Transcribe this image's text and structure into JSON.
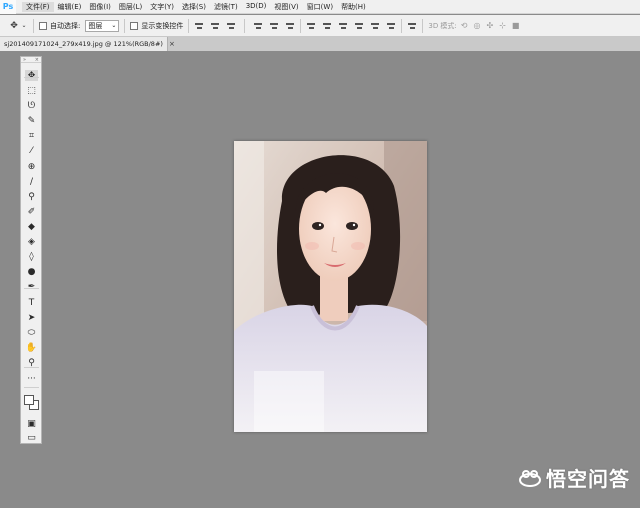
{
  "app": {
    "logo": "Ps"
  },
  "menu": [
    "文件(F)",
    "编辑(E)",
    "图像(I)",
    "图层(L)",
    "文字(Y)",
    "选择(S)",
    "滤镜(T)",
    "3D(D)",
    "视图(V)",
    "窗口(W)",
    "帮助(H)"
  ],
  "options": {
    "auto_select_label": "自动选择:",
    "auto_select_value": "图层",
    "show_transform_label": "显示变换控件",
    "mode_3d_label": "3D 模式:"
  },
  "document": {
    "tab_title": "sj201409171024_279x419.jpg @ 121%(RGB/8#)",
    "close_glyph": "×"
  },
  "tools_panel": {
    "grip_left": "»",
    "grip_right": "×",
    "tools": [
      {
        "name": "move-tool-icon",
        "glyph": "✥"
      },
      {
        "name": "marquee-tool-icon",
        "glyph": "⬚"
      },
      {
        "name": "lasso-tool-icon",
        "glyph": "ᘎ"
      },
      {
        "name": "quick-select-tool-icon",
        "glyph": "✎"
      },
      {
        "name": "crop-tool-icon",
        "glyph": "⌗"
      },
      {
        "name": "eyedropper-tool-icon",
        "glyph": "⁄"
      },
      {
        "name": "healing-brush-tool-icon",
        "glyph": "⊕"
      },
      {
        "name": "brush-tool-icon",
        "glyph": "∕"
      },
      {
        "name": "clone-stamp-tool-icon",
        "glyph": "⚲"
      },
      {
        "name": "history-brush-tool-icon",
        "glyph": "✐"
      },
      {
        "name": "eraser-tool-icon",
        "glyph": "◆"
      },
      {
        "name": "paint-bucket-tool-icon",
        "glyph": "◈"
      },
      {
        "name": "blur-tool-icon",
        "glyph": "◊"
      },
      {
        "name": "dodge-tool-icon",
        "glyph": "●"
      },
      {
        "name": "pen-tool-icon",
        "glyph": "✒"
      },
      {
        "name": "type-tool-icon",
        "glyph": "T"
      },
      {
        "name": "path-select-tool-icon",
        "glyph": "➤"
      },
      {
        "name": "shape-tool-icon",
        "glyph": "⬭"
      },
      {
        "name": "hand-tool-icon",
        "glyph": "✋"
      },
      {
        "name": "zoom-tool-icon",
        "glyph": "⚲"
      },
      {
        "name": "more-tools-icon",
        "glyph": "···"
      }
    ]
  },
  "watermark": {
    "text": "悟空问答"
  },
  "colors": {
    "workspace": "#8a8a8a",
    "panel": "#f0f0f0",
    "accent": "#31a8ff"
  }
}
